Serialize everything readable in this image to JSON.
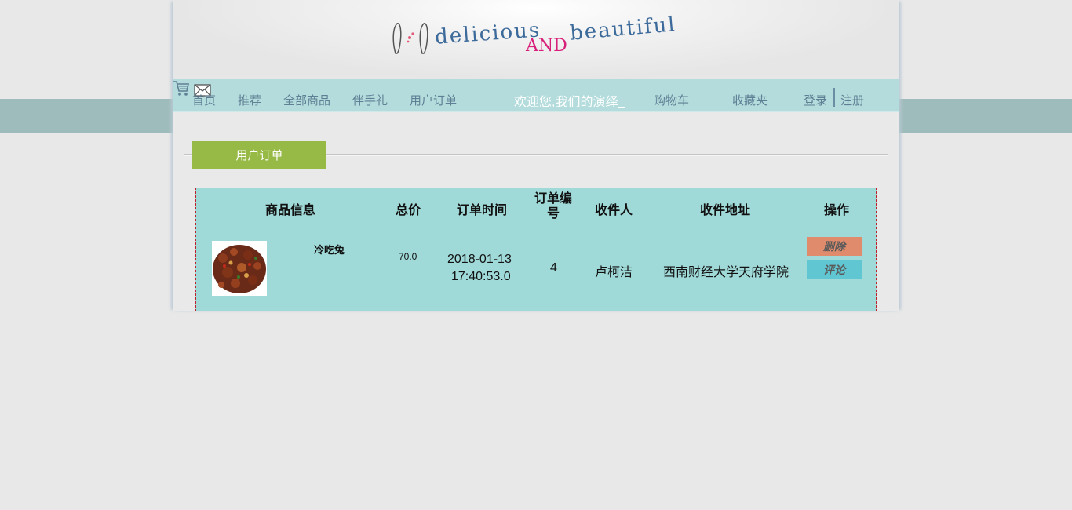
{
  "logo": {
    "word1": "delicious",
    "word2": "AND",
    "word3": "beautiful"
  },
  "nav": {
    "home": "首页",
    "recommend": "推荐",
    "all_products": "全部商品",
    "gifts": "伴手礼",
    "user_orders": "用户订单",
    "welcome": "欢迎您,我们的演绎_",
    "cart": "购物车",
    "favorites": "收藏夹",
    "login": "登录",
    "register": "注册"
  },
  "section": {
    "title": "用户订单"
  },
  "orders": {
    "headers": {
      "product": "商品信息",
      "total": "总价",
      "time": "订单时间",
      "order_no": "订单编号",
      "recipient": "收件人",
      "address": "收件地址",
      "action": "操作"
    },
    "rows": [
      {
        "product_name": "冷吃兔",
        "total": "70.0",
        "date": "2018-01-13",
        "time": "17:40:53.0",
        "order_no": "4",
        "recipient": "卢柯洁",
        "address": "西南财经大学天府学院",
        "delete_label": "删除",
        "comment_label": "评论"
      }
    ]
  },
  "colors": {
    "nav_bg": "#b4dcdc",
    "tab_bg": "#97b945",
    "table_bg": "#9fdad8",
    "delete_btn": "#e08c6c",
    "comment_btn": "#5fc6d2"
  }
}
